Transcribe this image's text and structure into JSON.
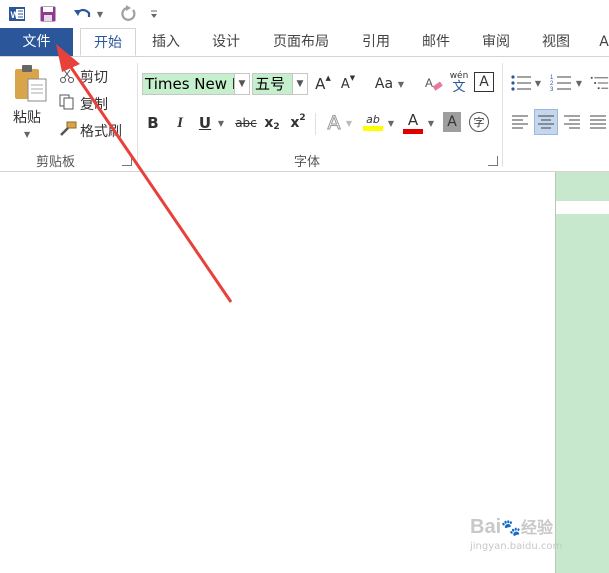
{
  "qat": {
    "word_icon": "word-icon",
    "save_icon": "save-icon",
    "undo_icon": "undo-icon",
    "redo_icon": "redo-icon",
    "customize_icon": "customize-icon"
  },
  "tabs": [
    {
      "label": "文件"
    },
    {
      "label": "开始"
    },
    {
      "label": "插入"
    },
    {
      "label": "设计"
    },
    {
      "label": "页面布局"
    },
    {
      "label": "引用"
    },
    {
      "label": "邮件"
    },
    {
      "label": "审阅"
    },
    {
      "label": "视图"
    },
    {
      "label": "A"
    }
  ],
  "clipboard": {
    "paste_label": "粘贴",
    "cut_label": "剪切",
    "copy_label": "复制",
    "format_painter_label": "格式刷",
    "group_name": "剪贴板"
  },
  "font": {
    "font_name": "Times New R",
    "font_size": "五号",
    "group_name": "字体",
    "grow_label": "A",
    "shrink_label": "A",
    "case_label": "Aa",
    "phonetic_top": "wén",
    "phonetic_bottom": "文",
    "border_label": "A",
    "bold": "B",
    "italic": "I",
    "underline": "U",
    "strike": "abc",
    "sub": "x",
    "sub_digit": "2",
    "sup": "x",
    "sup_digit": "2",
    "effects": "A",
    "font_color": "A",
    "shading": "A",
    "enclose": "字",
    "highlight_label": "ab"
  },
  "colors": {
    "file_tab": "#2b579a",
    "selection_green": "#c6efce",
    "page_green": "#c7e8cc",
    "arrow_red": "#e8403a",
    "highlight_yellow": "#ffff00",
    "font_red": "#e00000"
  },
  "watermark": {
    "brand": "Bai",
    "brand_suffix": "经验",
    "url": "jingyan.baidu.com"
  }
}
